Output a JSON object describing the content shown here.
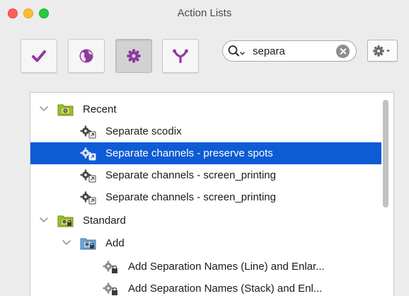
{
  "window": {
    "title": "Action Lists"
  },
  "toolbar": {
    "buttons": [
      {
        "name": "checkmark",
        "active": false
      },
      {
        "name": "globe",
        "active": false
      },
      {
        "name": "gear",
        "active": true
      },
      {
        "name": "branch",
        "active": false
      }
    ],
    "search": {
      "value": "separa"
    }
  },
  "tree": {
    "rows": [
      {
        "kind": "folder",
        "label": "Recent",
        "expanded": true,
        "level": 0
      },
      {
        "kind": "action",
        "label": "Separate scodix",
        "level": 1
      },
      {
        "kind": "action",
        "label": "Separate channels - preserve spots",
        "level": 1,
        "selected": true
      },
      {
        "kind": "action",
        "label": "Separate channels - screen_printing",
        "level": 1
      },
      {
        "kind": "action",
        "label": "Separate channels - screen_printing",
        "level": 1
      },
      {
        "kind": "folder",
        "label": "Standard",
        "expanded": true,
        "level": 0,
        "locked": true
      },
      {
        "kind": "folder",
        "label": "Add",
        "expanded": true,
        "level": 1,
        "locked": true,
        "blue": true
      },
      {
        "kind": "action",
        "label": "Add Separation Names (Line) and Enlar...",
        "level": 2,
        "locked": true
      },
      {
        "kind": "action",
        "label": "Add Separation Names (Stack) and Enl...",
        "level": 2,
        "locked": true
      }
    ]
  },
  "colors": {
    "selection": "#0d5bd5",
    "accent": "#8e3a9e",
    "folder": "#9ec22e"
  }
}
